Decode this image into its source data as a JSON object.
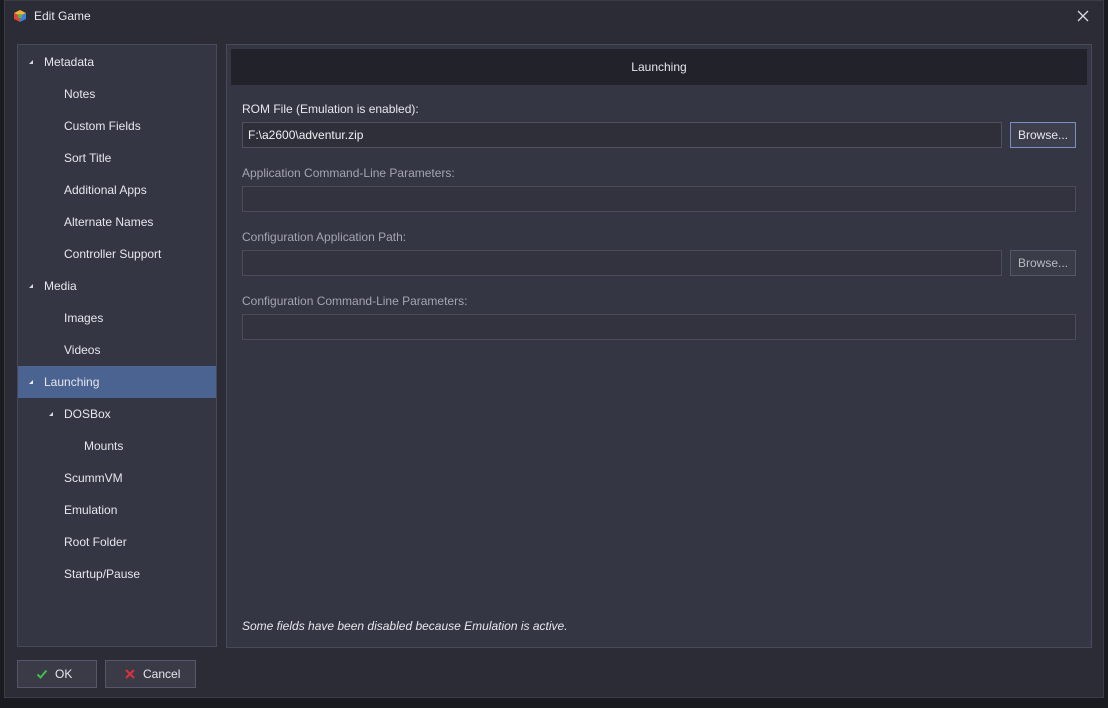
{
  "window": {
    "title": "Edit Game",
    "app_icon": "launchbox-cube-icon",
    "close_icon": "close-icon"
  },
  "sidebar": {
    "items": [
      {
        "label": "Metadata",
        "level": 0,
        "expanded": true
      },
      {
        "label": "Notes",
        "level": 1
      },
      {
        "label": "Custom Fields",
        "level": 1
      },
      {
        "label": "Sort Title",
        "level": 1
      },
      {
        "label": "Additional Apps",
        "level": 1
      },
      {
        "label": "Alternate Names",
        "level": 1
      },
      {
        "label": "Controller Support",
        "level": 1
      },
      {
        "label": "Media",
        "level": 0,
        "expanded": true
      },
      {
        "label": "Images",
        "level": 1
      },
      {
        "label": "Videos",
        "level": 1
      },
      {
        "label": "Launching",
        "level": 0,
        "expanded": true,
        "selected": true
      },
      {
        "label": "DOSBox",
        "level": 1,
        "expanded": true
      },
      {
        "label": "Mounts",
        "level": 2
      },
      {
        "label": "ScummVM",
        "level": 1
      },
      {
        "label": "Emulation",
        "level": 1
      },
      {
        "label": "Root Folder",
        "level": 1
      },
      {
        "label": "Startup/Pause",
        "level": 1
      }
    ]
  },
  "main": {
    "header": "Launching",
    "rom_file": {
      "label": "ROM File (Emulation is enabled):",
      "value": "F:\\a2600\\adventur.zip",
      "browse_label": "Browse..."
    },
    "app_params": {
      "label": "Application Command-Line Parameters:",
      "value": ""
    },
    "config_path": {
      "label": "Configuration Application Path:",
      "value": "",
      "browse_label": "Browse..."
    },
    "config_params": {
      "label": "Configuration Command-Line Parameters:",
      "value": ""
    },
    "note": "Some fields have been disabled because Emulation is active."
  },
  "footer": {
    "ok_label": "OK",
    "cancel_label": "Cancel"
  },
  "colors": {
    "selection": "#4a6391",
    "ok_check": "#3fbf4a",
    "cancel_x": "#d8323c"
  }
}
